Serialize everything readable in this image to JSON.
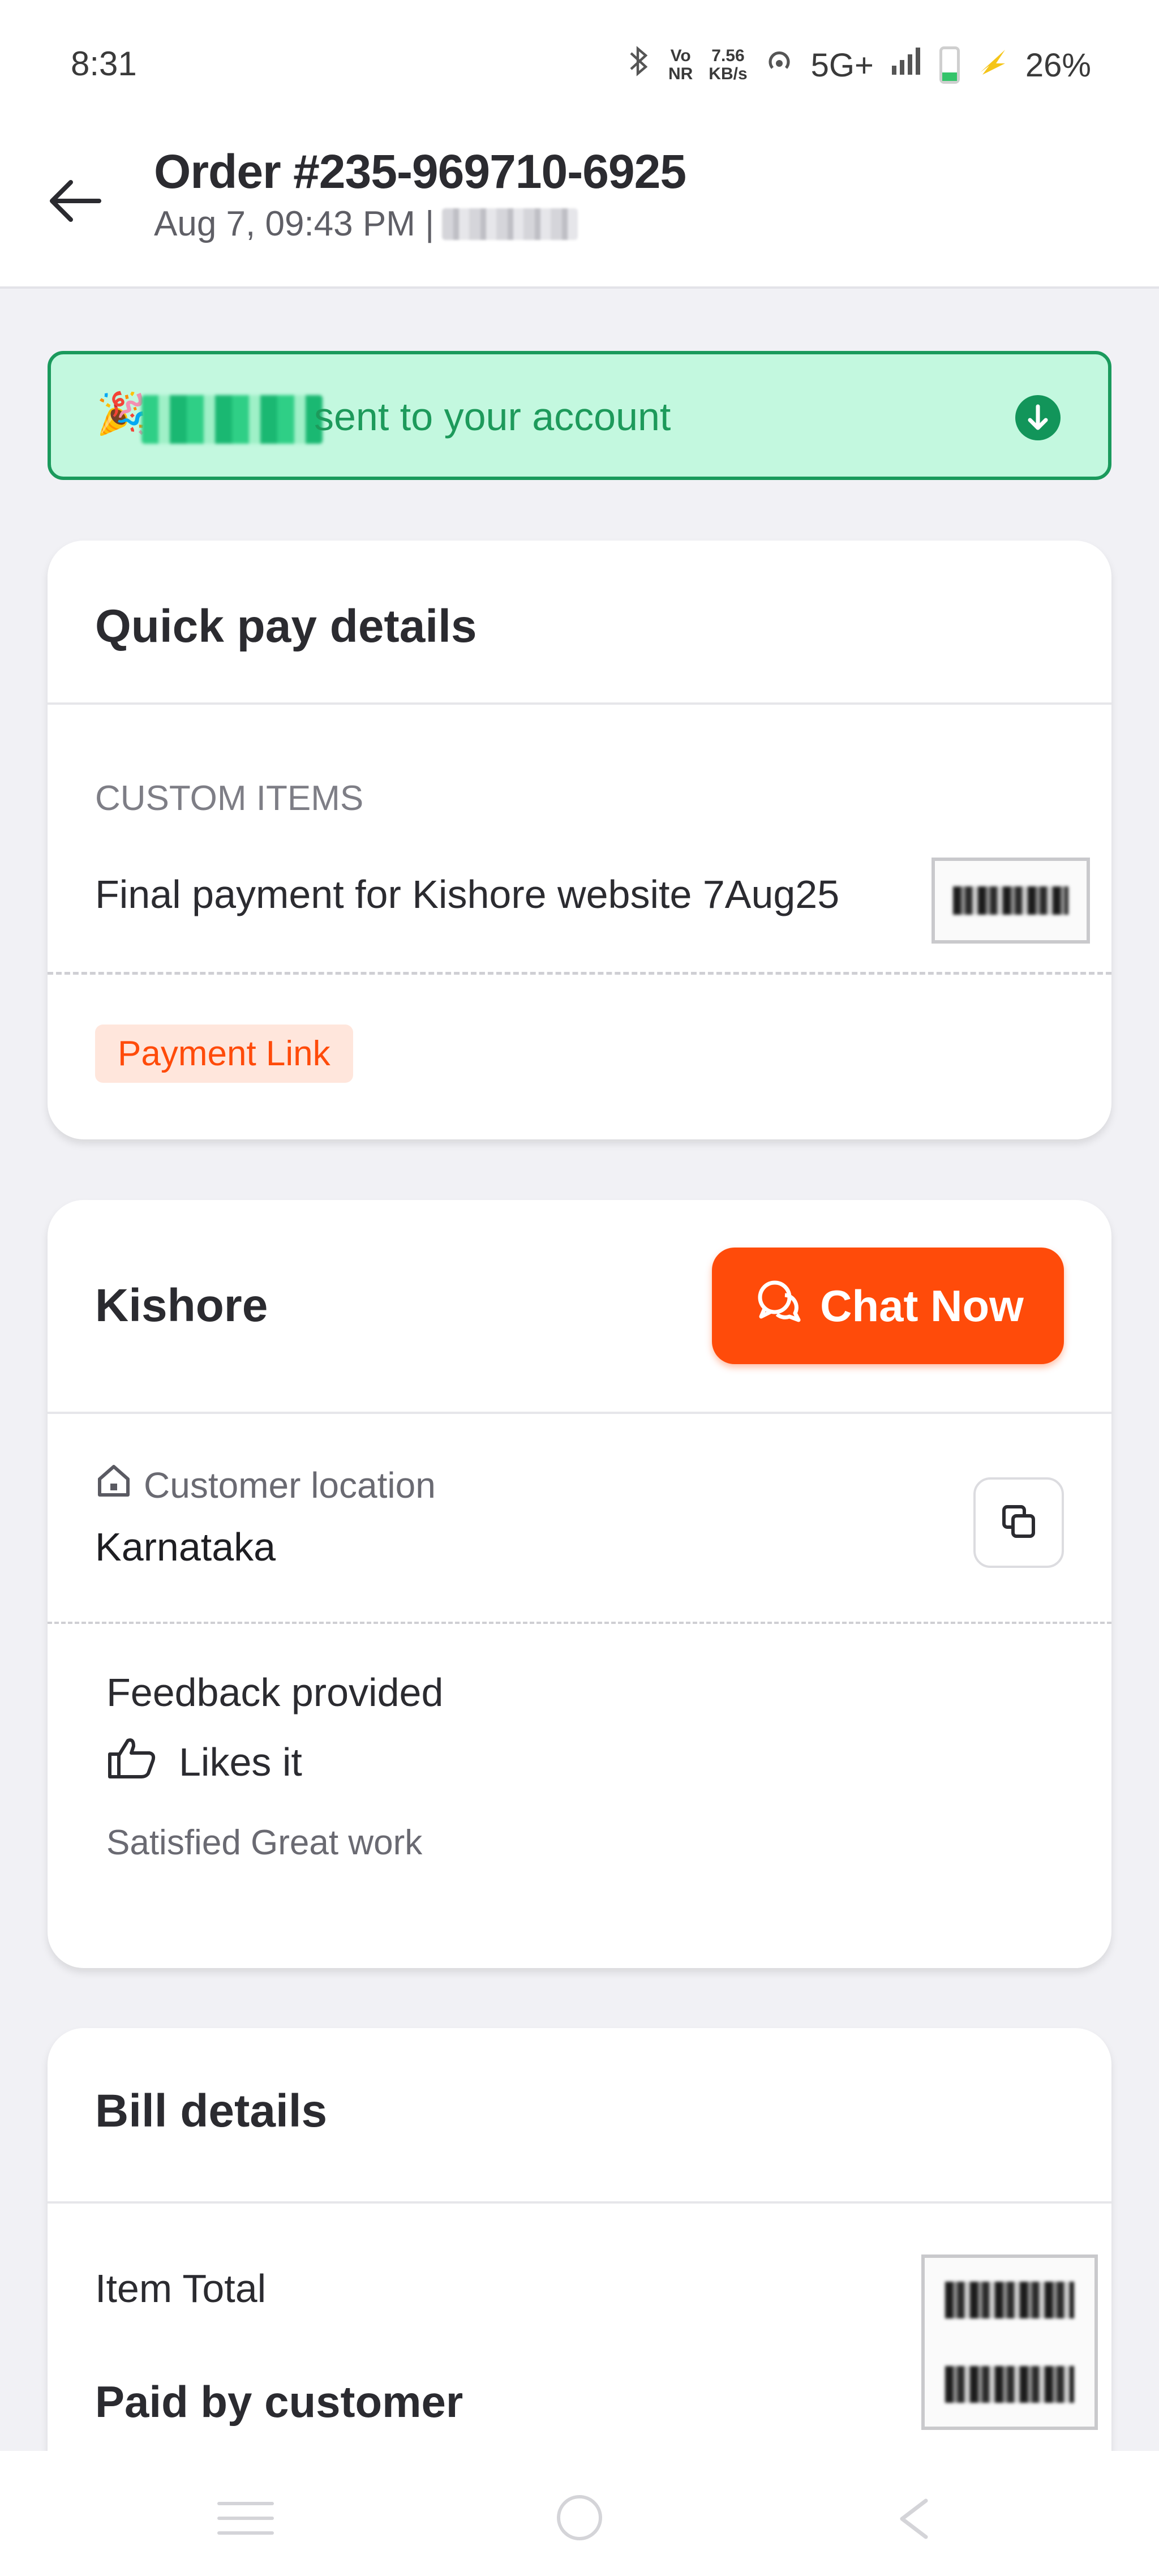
{
  "status_bar": {
    "time": "8:31",
    "vo_top": "Vo",
    "vo_bottom": "NR",
    "speed_top": "7.56",
    "speed_bottom": "KB/s",
    "network": "5G+",
    "battery": "26%",
    "battery_level": 0.26
  },
  "header": {
    "title": "Order #235-969710-6925",
    "subtitle": "Aug 7, 09:43 PM |"
  },
  "banner": {
    "emoji": "🎉",
    "text": "sent to your account",
    "icon": "arrow-down-circle-icon"
  },
  "quick_pay": {
    "title": "Quick pay details",
    "section_label": "CUSTOM ITEMS",
    "item_name": "Final payment for Kishore website 7Aug25",
    "tag": "Payment Link"
  },
  "customer": {
    "name": "Kishore",
    "chat_label": "Chat Now",
    "location_label": "Customer location",
    "location_value": "Karnataka",
    "feedback_title": "Feedback provided",
    "feedback_reaction": "Likes it",
    "feedback_comment": "Satisfied Great work"
  },
  "bill": {
    "title": "Bill details",
    "item_total_label": "Item Total",
    "paid_label": "Paid by customer"
  },
  "colors": {
    "accent": "#ff4b0a",
    "success_bg": "#c3f8df",
    "success": "#1a9a5c",
    "page_bg": "#f1f1f5"
  }
}
